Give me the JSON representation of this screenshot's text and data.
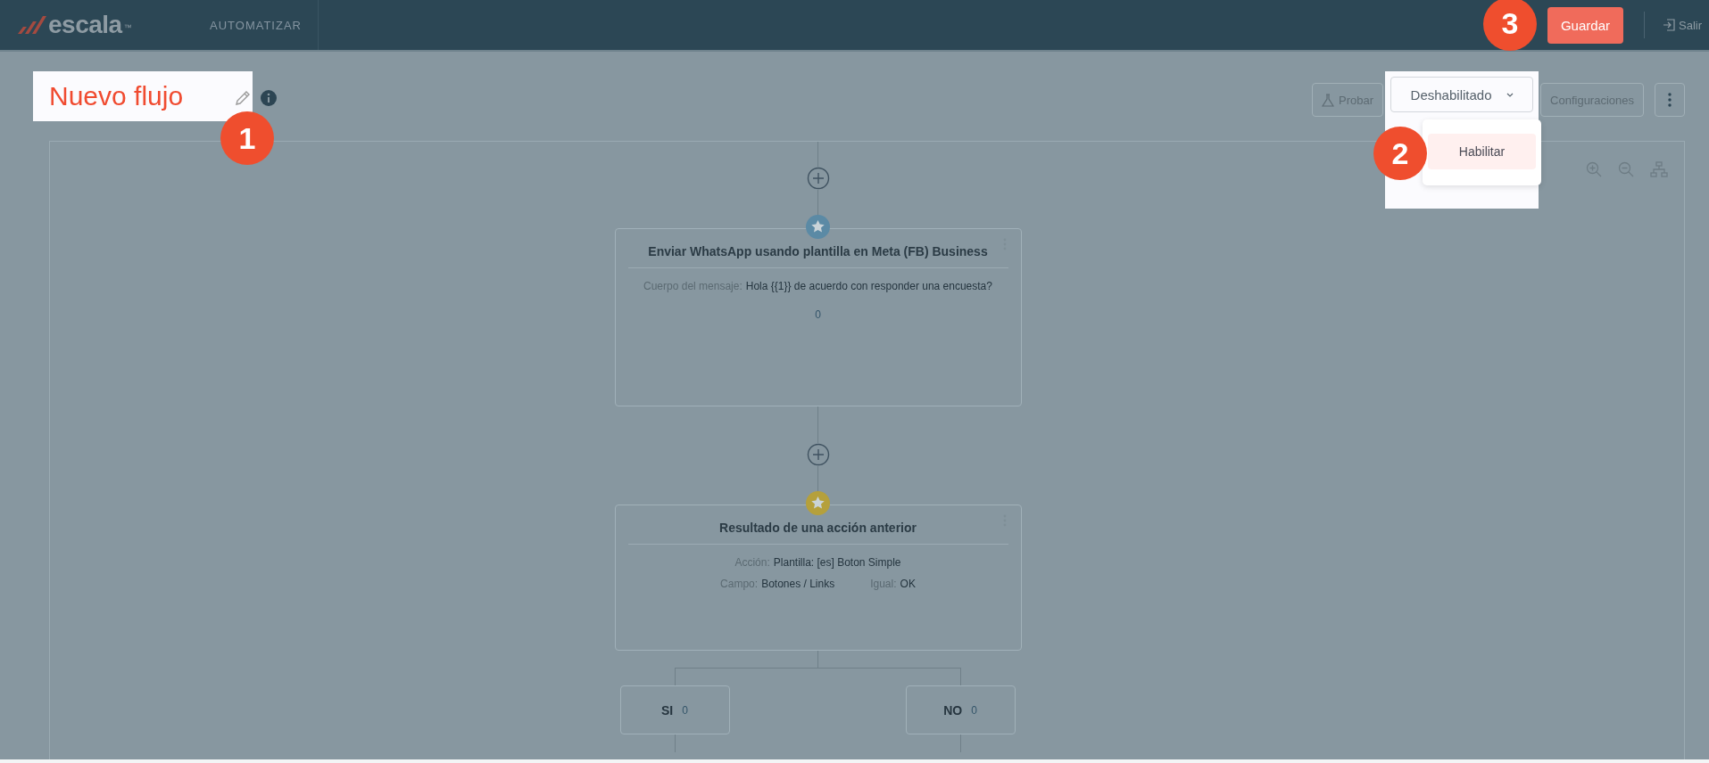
{
  "header": {
    "logo_text": "escala",
    "logo_mark": "™",
    "section": "AUTOMATIZAR",
    "save_button": "Guardar",
    "exit_link": "Salir"
  },
  "flow_title": "Nuevo flujo",
  "toolbar": {
    "test_button": "Probar",
    "status_dropdown": {
      "value": "Deshabilitado",
      "expanded": true,
      "options": [
        {
          "label": "Habilitar",
          "hovered": true
        }
      ]
    },
    "settings_button": "Configuraciones"
  },
  "callouts": [
    {
      "number": "1"
    },
    {
      "number": "2"
    },
    {
      "number": "3"
    }
  ],
  "nodes": [
    {
      "kind": "action",
      "color": "#5b8aa5",
      "title": "Enviar WhatsApp usando plantilla en Meta (FB) Business",
      "lines": [
        [
          {
            "label": "Cuerpo del mensaje:",
            "value": "Hola {{1}} de acuerdo con responder una encuesta?"
          }
        ]
      ],
      "count": "0"
    },
    {
      "kind": "condition",
      "color": "#b5a03c",
      "title": "Resultado de una acción anterior",
      "lines": [
        [
          {
            "label": "Acción:",
            "value": "Plantilla: [es] Boton Simple"
          }
        ],
        [
          {
            "label": "Campo:",
            "value": "Botones / Links"
          },
          {
            "label": "Igual:",
            "value": "OK"
          }
        ]
      ]
    }
  ],
  "branches": [
    {
      "label": "SI",
      "count": "0"
    },
    {
      "label": "NO",
      "count": "0"
    }
  ]
}
